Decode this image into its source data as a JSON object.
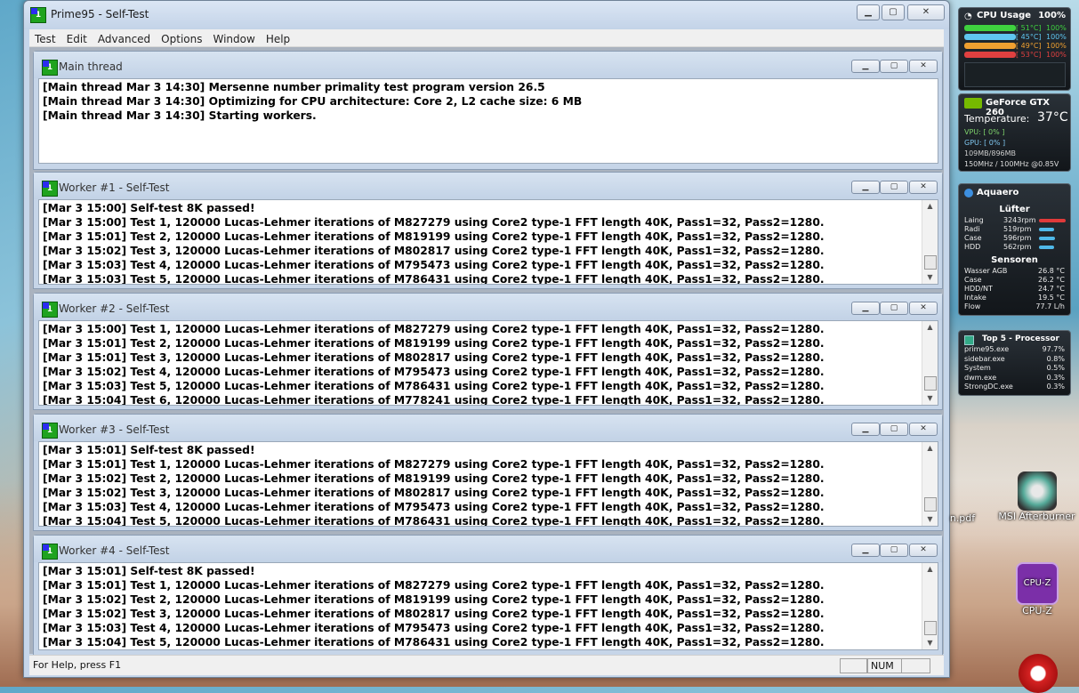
{
  "window": {
    "title": "Prime95 - Self-Test"
  },
  "menu": [
    "Test",
    "Edit",
    "Advanced",
    "Options",
    "Window",
    "Help"
  ],
  "children": [
    {
      "title": "Main thread",
      "scroll": false,
      "lines": [
        "[Main thread Mar 3 14:30] Mersenne number primality test program version 26.5",
        "[Main thread Mar 3 14:30] Optimizing for CPU architecture: Core 2, L2 cache size: 6 MB",
        "[Main thread Mar 3 14:30] Starting workers."
      ]
    },
    {
      "title": "Worker #1 - Self-Test",
      "scroll": true,
      "lines": [
        "[Mar 3 15:00] Self-test 8K passed!",
        "[Mar 3 15:00] Test 1, 120000 Lucas-Lehmer iterations of M827279 using Core2 type-1 FFT length 40K, Pass1=32, Pass2=1280.",
        "[Mar 3 15:01] Test 2, 120000 Lucas-Lehmer iterations of M819199 using Core2 type-1 FFT length 40K, Pass1=32, Pass2=1280.",
        "[Mar 3 15:02] Test 3, 120000 Lucas-Lehmer iterations of M802817 using Core2 type-1 FFT length 40K, Pass1=32, Pass2=1280.",
        "[Mar 3 15:03] Test 4, 120000 Lucas-Lehmer iterations of M795473 using Core2 type-1 FFT length 40K, Pass1=32, Pass2=1280.",
        "[Mar 3 15:03] Test 5, 120000 Lucas-Lehmer iterations of M786431 using Core2 type-1 FFT length 40K, Pass1=32, Pass2=1280."
      ]
    },
    {
      "title": "Worker #2 - Self-Test",
      "scroll": true,
      "lines": [
        "[Mar 3 15:00] Test 1, 120000 Lucas-Lehmer iterations of M827279 using Core2 type-1 FFT length 40K, Pass1=32, Pass2=1280.",
        "[Mar 3 15:01] Test 2, 120000 Lucas-Lehmer iterations of M819199 using Core2 type-1 FFT length 40K, Pass1=32, Pass2=1280.",
        "[Mar 3 15:01] Test 3, 120000 Lucas-Lehmer iterations of M802817 using Core2 type-1 FFT length 40K, Pass1=32, Pass2=1280.",
        "[Mar 3 15:02] Test 4, 120000 Lucas-Lehmer iterations of M795473 using Core2 type-1 FFT length 40K, Pass1=32, Pass2=1280.",
        "[Mar 3 15:03] Test 5, 120000 Lucas-Lehmer iterations of M786431 using Core2 type-1 FFT length 40K, Pass1=32, Pass2=1280.",
        "[Mar 3 15:04] Test 6, 120000 Lucas-Lehmer iterations of M778241 using Core2 type-1 FFT length 40K, Pass1=32, Pass2=1280."
      ]
    },
    {
      "title": "Worker #3 - Self-Test",
      "scroll": true,
      "lines": [
        "[Mar 3 15:01] Self-test 8K passed!",
        "[Mar 3 15:01] Test 1, 120000 Lucas-Lehmer iterations of M827279 using Core2 type-1 FFT length 40K, Pass1=32, Pass2=1280.",
        "[Mar 3 15:02] Test 2, 120000 Lucas-Lehmer iterations of M819199 using Core2 type-1 FFT length 40K, Pass1=32, Pass2=1280.",
        "[Mar 3 15:02] Test 3, 120000 Lucas-Lehmer iterations of M802817 using Core2 type-1 FFT length 40K, Pass1=32, Pass2=1280.",
        "[Mar 3 15:03] Test 4, 120000 Lucas-Lehmer iterations of M795473 using Core2 type-1 FFT length 40K, Pass1=32, Pass2=1280.",
        "[Mar 3 15:04] Test 5, 120000 Lucas-Lehmer iterations of M786431 using Core2 type-1 FFT length 40K, Pass1=32, Pass2=1280."
      ]
    },
    {
      "title": "Worker #4 - Self-Test",
      "scroll": true,
      "lines": [
        "[Mar 3 15:01] Self-test 8K passed!",
        "[Mar 3 15:01] Test 1, 120000 Lucas-Lehmer iterations of M827279 using Core2 type-1 FFT length 40K, Pass1=32, Pass2=1280.",
        "[Mar 3 15:02] Test 2, 120000 Lucas-Lehmer iterations of M819199 using Core2 type-1 FFT length 40K, Pass1=32, Pass2=1280.",
        "[Mar 3 15:02] Test 3, 120000 Lucas-Lehmer iterations of M802817 using Core2 type-1 FFT length 40K, Pass1=32, Pass2=1280.",
        "[Mar 3 15:03] Test 4, 120000 Lucas-Lehmer iterations of M795473 using Core2 type-1 FFT length 40K, Pass1=32, Pass2=1280.",
        "[Mar 3 15:04] Test 5, 120000 Lucas-Lehmer iterations of M786431 using Core2 type-1 FFT length 40K, Pass1=32, Pass2=1280."
      ]
    }
  ],
  "status": {
    "help": "For Help, press F1",
    "num": "NUM"
  },
  "cpu_gadget": {
    "title": "CPU Usage",
    "total": "100%",
    "cores": [
      {
        "temp": "[ 51°C]",
        "usage": "100%",
        "color": "#3fd13f"
      },
      {
        "temp": "[ 45°C]",
        "usage": "100%",
        "color": "#5fc6f0"
      },
      {
        "temp": "[ 49°C]",
        "usage": "100%",
        "color": "#f0a030"
      },
      {
        "temp": "[ 53°C]",
        "usage": "100%",
        "color": "#e04040"
      }
    ]
  },
  "gpu_gadget": {
    "title": "GeForce GTX 260",
    "temp_label": "Temperature:",
    "temp": "37°C",
    "vpu": "VPU: [ 0% ]",
    "gpu": "GPU: [ 0% ]",
    "mem": "109MB/896MB",
    "clock": "150MHz / 100MHz @0.85V"
  },
  "aquaero": {
    "title": "Aquaero",
    "fans_header": "Lüfter",
    "fans": [
      {
        "name": "Laing",
        "rpm": "3243rpm",
        "color": "#e03a3a",
        "level": 1.0
      },
      {
        "name": "Radi",
        "rpm": "519rpm",
        "color": "#4fb8e8",
        "level": 0.55
      },
      {
        "name": "Case",
        "rpm": "596rpm",
        "color": "#4fb8e8",
        "level": 0.6
      },
      {
        "name": "HDD",
        "rpm": "562rpm",
        "color": "#4fb8e8",
        "level": 0.58
      }
    ],
    "sensors_header": "Sensoren",
    "sensors": [
      {
        "name": "Wasser AGB",
        "value": "26.8 °C"
      },
      {
        "name": "Case",
        "value": "26.2 °C"
      },
      {
        "name": "HDD/NT",
        "value": "24.7 °C"
      },
      {
        "name": "Intake",
        "value": "19.5 °C"
      },
      {
        "name": "Flow",
        "value": "77.7 L/h"
      }
    ]
  },
  "top5": {
    "title": "Top 5 - Processor",
    "rows": [
      {
        "name": "prime95.exe",
        "value": "97.7%"
      },
      {
        "name": "sidebar.exe",
        "value": "0.8%"
      },
      {
        "name": "System",
        "value": "0.5%"
      },
      {
        "name": "dwm.exe",
        "value": "0.3%"
      },
      {
        "name": "StrongDC.exe",
        "value": "0.3%"
      }
    ]
  },
  "desktop": {
    "pdf_label": "n.pdf",
    "msi_label": "MSI Afterburner",
    "cpuz_label": "CPU-Z",
    "cpuz_badge": "CPU-Z"
  }
}
